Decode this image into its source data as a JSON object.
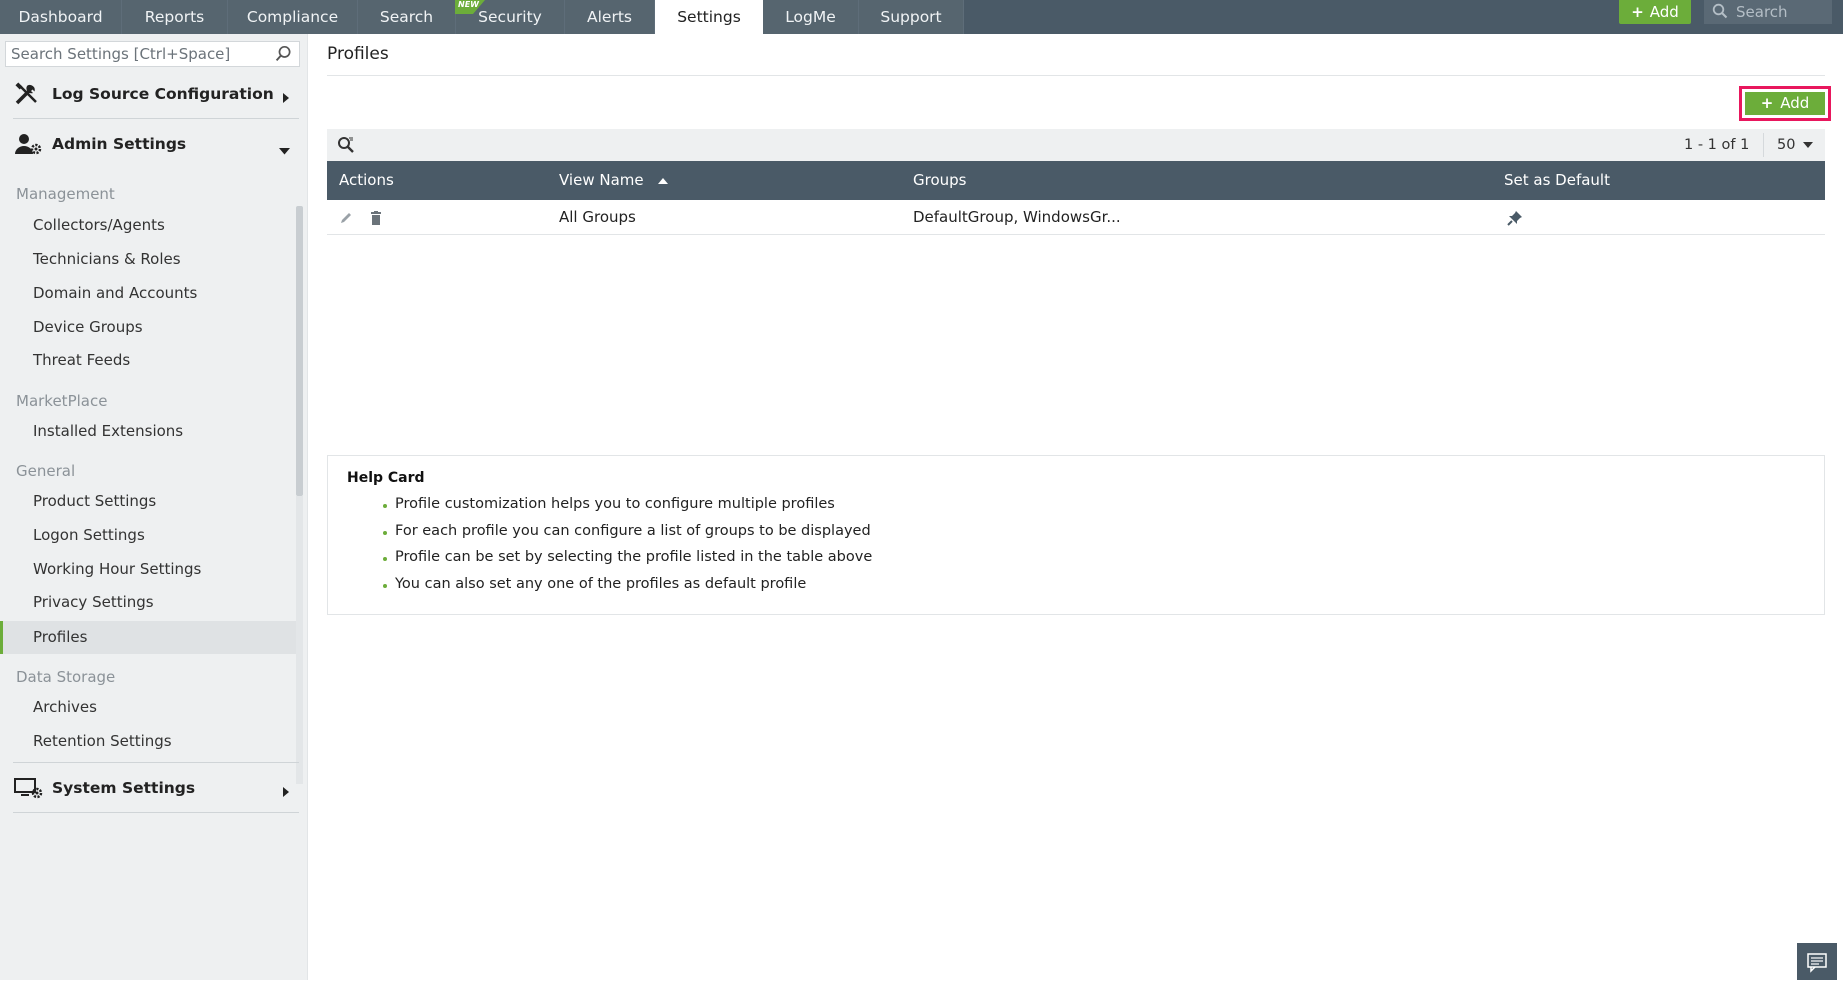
{
  "topnav": {
    "tabs": [
      {
        "label": "Dashboard"
      },
      {
        "label": "Reports"
      },
      {
        "label": "Compliance"
      },
      {
        "label": "Search"
      },
      {
        "label": "Security",
        "badge": "NEW"
      },
      {
        "label": "Alerts"
      },
      {
        "label": "Settings",
        "active": true
      },
      {
        "label": "LogMe"
      },
      {
        "label": "Support"
      }
    ],
    "add_label": "Add",
    "search_placeholder": "Search"
  },
  "sidebar": {
    "search_placeholder": "Search Settings [Ctrl+Space]",
    "sections": {
      "log_source": {
        "label": "Log Source Configuration",
        "icon": "tools-icon"
      },
      "admin": {
        "label": "Admin Settings",
        "icon": "user-gear-icon"
      },
      "system": {
        "label": "System Settings",
        "icon": "monitor-gear-icon"
      }
    },
    "groups": {
      "management": {
        "label": "Management",
        "items": [
          "Collectors/Agents",
          "Technicians & Roles",
          "Domain and Accounts",
          "Device Groups",
          "Threat Feeds"
        ]
      },
      "marketplace": {
        "label": "MarketPlace",
        "items": [
          "Installed Extensions"
        ]
      },
      "general": {
        "label": "General",
        "items": [
          "Product Settings",
          "Logon Settings",
          "Working Hour Settings",
          "Privacy Settings",
          "Profiles"
        ]
      },
      "data_storage": {
        "label": "Data Storage",
        "items": [
          "Archives",
          "Retention Settings"
        ]
      }
    },
    "active_item": "Profiles"
  },
  "main": {
    "title": "Profiles",
    "add_label": "Add",
    "pager": "1 - 1 of 1",
    "per_page": "50",
    "columns": {
      "actions": "Actions",
      "view_name": "View Name",
      "groups": "Groups",
      "set_default": "Set as Default"
    },
    "rows": [
      {
        "view_name": "All Groups",
        "groups": "DefaultGroup, WindowsGr..."
      }
    ],
    "help": {
      "title": "Help Card",
      "items": [
        "Profile customization helps you to configure multiple profiles",
        "For each profile you can configure a list of groups to be displayed",
        "Profile can be set by selecting the profile listed in the table above",
        "You can also set any one of the profiles as default profile"
      ]
    }
  },
  "colors": {
    "nav_bg": "#4a5a67",
    "accent_green": "#6cad3a",
    "highlight": "#e8175d",
    "sidebar_bg": "#eef0f1"
  }
}
